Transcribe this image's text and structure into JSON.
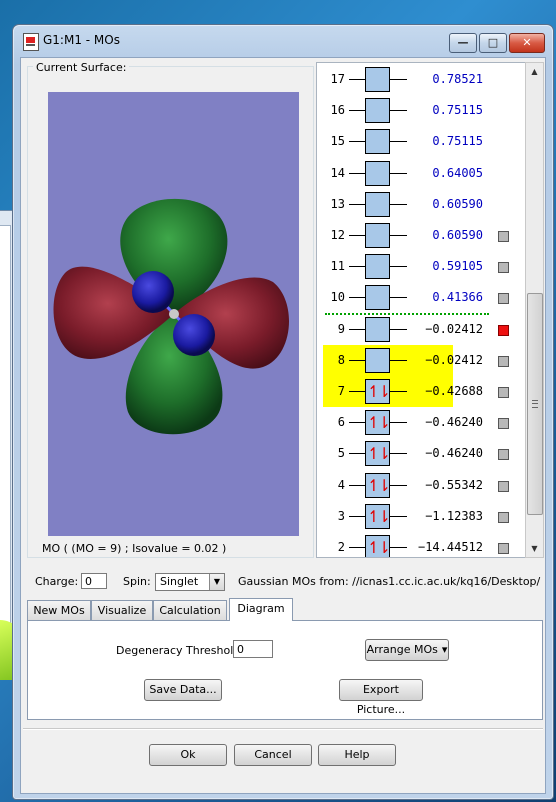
{
  "window": {
    "title": "G1:M1 - MOs",
    "controls": {
      "minimize": "—",
      "maximize": "□",
      "close": "✕"
    }
  },
  "surface": {
    "group_label": "Current Surface:",
    "caption": "MO ( (MO = 9) ; Isovalue = 0.02 )"
  },
  "orbitals": [
    {
      "index": "17",
      "energy": "0.78521",
      "occupancy": 0,
      "highlighted": false,
      "marker": "none"
    },
    {
      "index": "16",
      "energy": "0.75115",
      "occupancy": 0,
      "highlighted": false,
      "marker": "none"
    },
    {
      "index": "15",
      "energy": "0.75115",
      "occupancy": 0,
      "highlighted": false,
      "marker": "none"
    },
    {
      "index": "14",
      "energy": "0.64005",
      "occupancy": 0,
      "highlighted": false,
      "marker": "none"
    },
    {
      "index": "13",
      "energy": "0.60590",
      "occupancy": 0,
      "highlighted": false,
      "marker": "none"
    },
    {
      "index": "12",
      "energy": "0.60590",
      "occupancy": 0,
      "highlighted": false,
      "marker": "gray"
    },
    {
      "index": "11",
      "energy": "0.59105",
      "occupancy": 0,
      "highlighted": false,
      "marker": "gray"
    },
    {
      "index": "10",
      "energy": "0.41366",
      "occupancy": 0,
      "highlighted": false,
      "marker": "gray"
    },
    {
      "index": "9",
      "energy": "−0.02412",
      "occupancy": 0,
      "highlighted": false,
      "marker": "red"
    },
    {
      "index": "8",
      "energy": "−0.02412",
      "occupancy": 0,
      "highlighted": true,
      "marker": "gray"
    },
    {
      "index": "7",
      "energy": "−0.42688",
      "occupancy": 2,
      "highlighted": true,
      "marker": "gray"
    },
    {
      "index": "6",
      "energy": "−0.46240",
      "occupancy": 2,
      "highlighted": false,
      "marker": "gray"
    },
    {
      "index": "5",
      "energy": "−0.46240",
      "occupancy": 2,
      "highlighted": false,
      "marker": "gray"
    },
    {
      "index": "4",
      "energy": "−0.55342",
      "occupancy": 2,
      "highlighted": false,
      "marker": "gray"
    },
    {
      "index": "3",
      "energy": "−1.12383",
      "occupancy": 2,
      "highlighted": false,
      "marker": "gray"
    },
    {
      "index": "2",
      "energy": "−14.44512",
      "occupancy": 2,
      "highlighted": false,
      "marker": "gray"
    }
  ],
  "diagram_colors": {
    "positive_energy": "#0000c0",
    "negative_energy": "#000000",
    "highlight": "#ffff00",
    "orbital_fill": "#a8c8e8",
    "electron_arrow": "#e00000",
    "homo_lumo_divider": "#00a000"
  },
  "properties": {
    "charge_label": "Charge:",
    "charge_value": "0",
    "spin_label": "Spin:",
    "spin_value": "Singlet",
    "source_text": "Gaussian MOs from:  //icnas1.cc.ic.ac.uk/kq16/Desktop/"
  },
  "tabs": [
    "New MOs",
    "Visualize",
    "Calculation",
    "Diagram"
  ],
  "active_tab": "Diagram",
  "diagram_tab": {
    "threshold_label": "Degeneracy Threshold:",
    "threshold_value": "0",
    "arrange_button": "Arrange MOs",
    "save_button": "Save Data...",
    "export_button": "Export Picture..."
  },
  "footer": {
    "ok": "Ok",
    "cancel": "Cancel",
    "help": "Help"
  }
}
